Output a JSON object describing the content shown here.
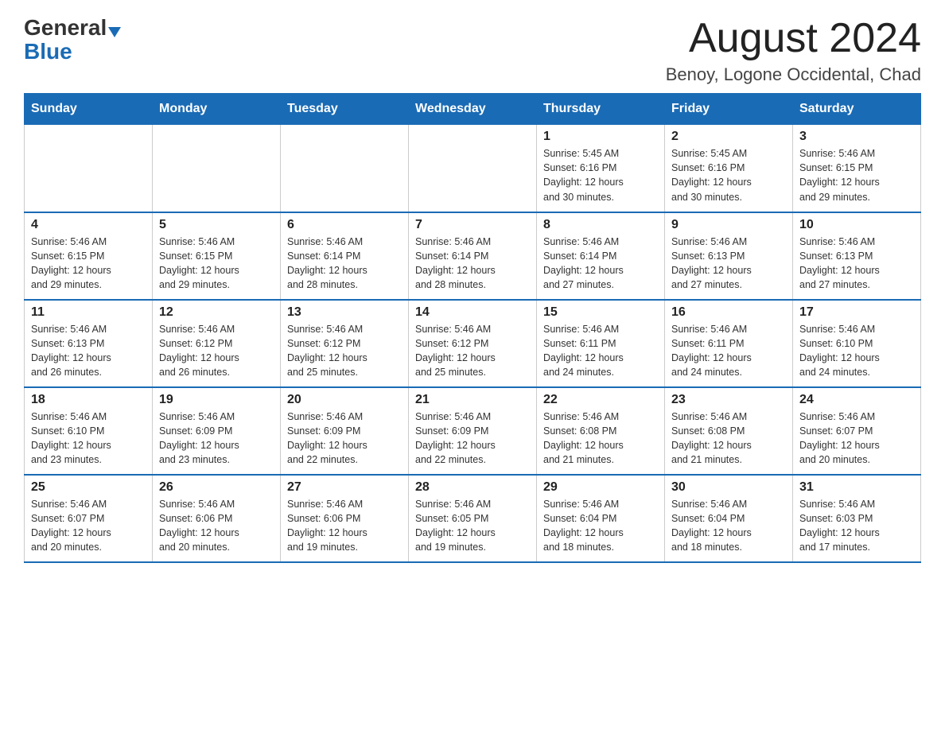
{
  "header": {
    "logo_general": "General",
    "logo_blue": "Blue",
    "month": "August 2024",
    "location": "Benoy, Logone Occidental, Chad"
  },
  "weekdays": [
    "Sunday",
    "Monday",
    "Tuesday",
    "Wednesday",
    "Thursday",
    "Friday",
    "Saturday"
  ],
  "weeks": [
    [
      {
        "day": "",
        "info": ""
      },
      {
        "day": "",
        "info": ""
      },
      {
        "day": "",
        "info": ""
      },
      {
        "day": "",
        "info": ""
      },
      {
        "day": "1",
        "info": "Sunrise: 5:45 AM\nSunset: 6:16 PM\nDaylight: 12 hours\nand 30 minutes."
      },
      {
        "day": "2",
        "info": "Sunrise: 5:45 AM\nSunset: 6:16 PM\nDaylight: 12 hours\nand 30 minutes."
      },
      {
        "day": "3",
        "info": "Sunrise: 5:46 AM\nSunset: 6:15 PM\nDaylight: 12 hours\nand 29 minutes."
      }
    ],
    [
      {
        "day": "4",
        "info": "Sunrise: 5:46 AM\nSunset: 6:15 PM\nDaylight: 12 hours\nand 29 minutes."
      },
      {
        "day": "5",
        "info": "Sunrise: 5:46 AM\nSunset: 6:15 PM\nDaylight: 12 hours\nand 29 minutes."
      },
      {
        "day": "6",
        "info": "Sunrise: 5:46 AM\nSunset: 6:14 PM\nDaylight: 12 hours\nand 28 minutes."
      },
      {
        "day": "7",
        "info": "Sunrise: 5:46 AM\nSunset: 6:14 PM\nDaylight: 12 hours\nand 28 minutes."
      },
      {
        "day": "8",
        "info": "Sunrise: 5:46 AM\nSunset: 6:14 PM\nDaylight: 12 hours\nand 27 minutes."
      },
      {
        "day": "9",
        "info": "Sunrise: 5:46 AM\nSunset: 6:13 PM\nDaylight: 12 hours\nand 27 minutes."
      },
      {
        "day": "10",
        "info": "Sunrise: 5:46 AM\nSunset: 6:13 PM\nDaylight: 12 hours\nand 27 minutes."
      }
    ],
    [
      {
        "day": "11",
        "info": "Sunrise: 5:46 AM\nSunset: 6:13 PM\nDaylight: 12 hours\nand 26 minutes."
      },
      {
        "day": "12",
        "info": "Sunrise: 5:46 AM\nSunset: 6:12 PM\nDaylight: 12 hours\nand 26 minutes."
      },
      {
        "day": "13",
        "info": "Sunrise: 5:46 AM\nSunset: 6:12 PM\nDaylight: 12 hours\nand 25 minutes."
      },
      {
        "day": "14",
        "info": "Sunrise: 5:46 AM\nSunset: 6:12 PM\nDaylight: 12 hours\nand 25 minutes."
      },
      {
        "day": "15",
        "info": "Sunrise: 5:46 AM\nSunset: 6:11 PM\nDaylight: 12 hours\nand 24 minutes."
      },
      {
        "day": "16",
        "info": "Sunrise: 5:46 AM\nSunset: 6:11 PM\nDaylight: 12 hours\nand 24 minutes."
      },
      {
        "day": "17",
        "info": "Sunrise: 5:46 AM\nSunset: 6:10 PM\nDaylight: 12 hours\nand 24 minutes."
      }
    ],
    [
      {
        "day": "18",
        "info": "Sunrise: 5:46 AM\nSunset: 6:10 PM\nDaylight: 12 hours\nand 23 minutes."
      },
      {
        "day": "19",
        "info": "Sunrise: 5:46 AM\nSunset: 6:09 PM\nDaylight: 12 hours\nand 23 minutes."
      },
      {
        "day": "20",
        "info": "Sunrise: 5:46 AM\nSunset: 6:09 PM\nDaylight: 12 hours\nand 22 minutes."
      },
      {
        "day": "21",
        "info": "Sunrise: 5:46 AM\nSunset: 6:09 PM\nDaylight: 12 hours\nand 22 minutes."
      },
      {
        "day": "22",
        "info": "Sunrise: 5:46 AM\nSunset: 6:08 PM\nDaylight: 12 hours\nand 21 minutes."
      },
      {
        "day": "23",
        "info": "Sunrise: 5:46 AM\nSunset: 6:08 PM\nDaylight: 12 hours\nand 21 minutes."
      },
      {
        "day": "24",
        "info": "Sunrise: 5:46 AM\nSunset: 6:07 PM\nDaylight: 12 hours\nand 20 minutes."
      }
    ],
    [
      {
        "day": "25",
        "info": "Sunrise: 5:46 AM\nSunset: 6:07 PM\nDaylight: 12 hours\nand 20 minutes."
      },
      {
        "day": "26",
        "info": "Sunrise: 5:46 AM\nSunset: 6:06 PM\nDaylight: 12 hours\nand 20 minutes."
      },
      {
        "day": "27",
        "info": "Sunrise: 5:46 AM\nSunset: 6:06 PM\nDaylight: 12 hours\nand 19 minutes."
      },
      {
        "day": "28",
        "info": "Sunrise: 5:46 AM\nSunset: 6:05 PM\nDaylight: 12 hours\nand 19 minutes."
      },
      {
        "day": "29",
        "info": "Sunrise: 5:46 AM\nSunset: 6:04 PM\nDaylight: 12 hours\nand 18 minutes."
      },
      {
        "day": "30",
        "info": "Sunrise: 5:46 AM\nSunset: 6:04 PM\nDaylight: 12 hours\nand 18 minutes."
      },
      {
        "day": "31",
        "info": "Sunrise: 5:46 AM\nSunset: 6:03 PM\nDaylight: 12 hours\nand 17 minutes."
      }
    ]
  ]
}
